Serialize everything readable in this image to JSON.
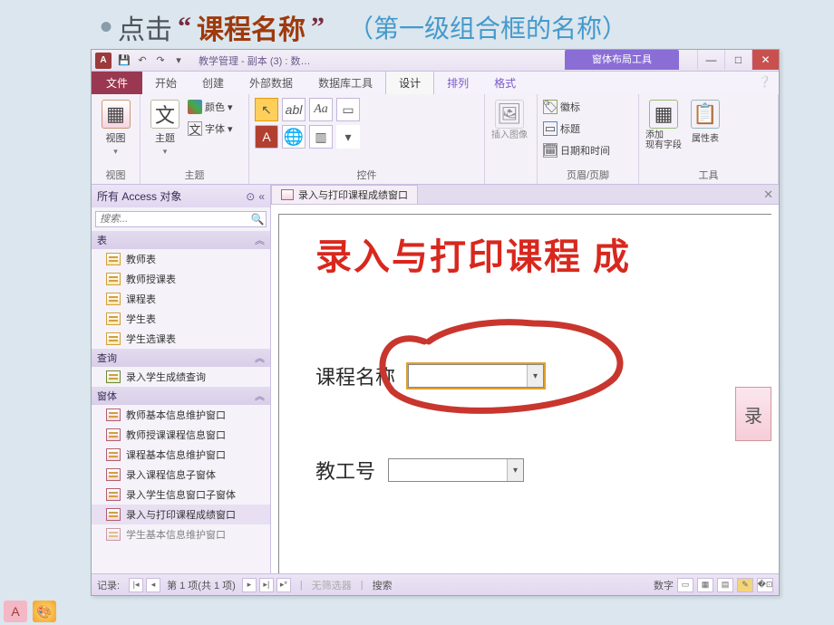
{
  "slide": {
    "bullet": "•",
    "text1": "点击",
    "quote_l": "“",
    "key": "课程名称",
    "quote_r": "”",
    "note": "（第一级组合框的名称）"
  },
  "titlebar": {
    "app_icon": "A",
    "qat": {
      "save": "💾",
      "undo": "↶",
      "redo": "↷",
      "more": "▾"
    },
    "title": "教学管理 - 副本 (3) : 数…",
    "context_title": "窗体布局工具",
    "min": "—",
    "max": "□",
    "close": "✕"
  },
  "tabs": {
    "file": "文件",
    "items": [
      "开始",
      "创建",
      "外部数据",
      "数据库工具",
      "设计",
      "排列",
      "格式"
    ],
    "active_index": 4,
    "help": "❔"
  },
  "ribbon": {
    "g_view": {
      "label": "视图",
      "btn": "视图"
    },
    "g_theme": {
      "label": "主题",
      "btn": "主题",
      "color": "颜色",
      "font": "字体"
    },
    "g_controls": {
      "label": "控件",
      "icons": {
        "arrow": "↖",
        "tbx": "abl",
        "aa": "Aa",
        "rect": "▭",
        "logo": "A",
        "globe": "🌐",
        "combo": "▥",
        "more": "▾"
      }
    },
    "g_image": {
      "label": "",
      "btn": "插入图像"
    },
    "g_header": {
      "label": "页眉/页脚",
      "logo": "徽标",
      "title": "标题",
      "datetime": "日期和时间"
    },
    "g_tools": {
      "label": "工具",
      "addfield": "添加\n现有字段",
      "propsheet": "属性表"
    }
  },
  "nav": {
    "header": "所有 Access 对象",
    "search_placeholder": "搜索...",
    "cat_table": "表",
    "tables": [
      "教师表",
      "教师授课表",
      "课程表",
      "学生表",
      "学生选课表"
    ],
    "cat_query": "查询",
    "queries": [
      "录入学生成绩查询"
    ],
    "cat_form": "窗体",
    "forms": [
      "教师基本信息维护窗口",
      "教师授课课程信息窗口",
      "课程基本信息维护窗口",
      "录入课程信息子窗体",
      "录入学生信息窗口子窗体",
      "录入与打印课程成绩窗口",
      "学生基本信息维护窗口"
    ]
  },
  "doc": {
    "tab_label": "录入与打印课程成绩窗口",
    "close": "✕",
    "form_title": "录入与打印课程 成",
    "field1_label": "课程名称",
    "field2_label": "教工号",
    "side_btn": "录"
  },
  "status": {
    "record_label": "记录:",
    "nav_first": "|◂",
    "nav_prev": "◂",
    "pos": "第 1 项(共 1 项)",
    "nav_next": "▸",
    "nav_last": "▸|",
    "nav_new": "▸*",
    "nofilter": "无筛选器",
    "search": "搜索",
    "mode": "数字"
  }
}
